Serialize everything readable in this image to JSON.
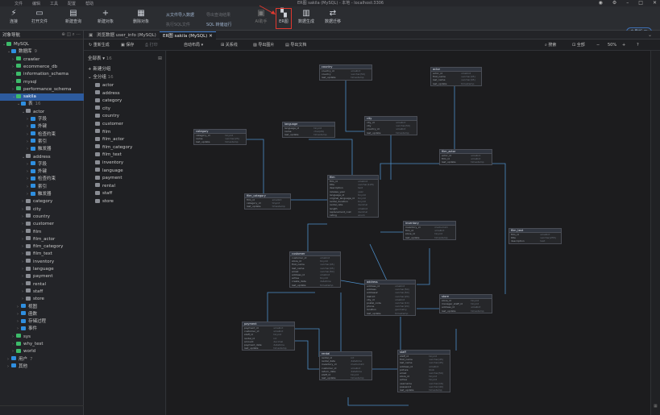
{
  "window": {
    "title": "ER图 sakila (MySQL) - 本地 - localhost:3306"
  },
  "menu": [
    "文件",
    "编辑",
    "工具",
    "配置",
    "帮助"
  ],
  "toolbar": {
    "connect": "连接",
    "open_file": "打开文件",
    "new_query": "新建查询",
    "new_object": "新建对象",
    "delete_object": "删除对象",
    "import_from_file": "从文件导入数据",
    "export_results": "导出查询结果",
    "execute_sql": "执行SQL文件",
    "export_wizard": "导出向导",
    "run_sql": "SQL 转储运行",
    "ai_assistant": "AI助手",
    "er_diagram": "ER图",
    "data_generation": "数据生成",
    "data_comparison": "数据迁移",
    "vip_badge": "会员版 AI"
  },
  "left_pane": {
    "title": "对象导航",
    "connection": "MySQL",
    "group_db": "数据库",
    "count_db": "9",
    "databases": [
      "crawler",
      "ecommerce_db",
      "information_schema",
      "mysql",
      "performance_schema",
      "sakila",
      "sys",
      "why_test",
      "world"
    ],
    "sakila_children": {
      "tables_label": "表",
      "tables_count": "16",
      "actor": "actor",
      "actor_children": [
        "字段",
        "外键",
        "检查约束",
        "索引",
        "触发器"
      ],
      "address": "address",
      "address_children": [
        "字段",
        "外键",
        "检查约束",
        "索引",
        "触发器"
      ],
      "tables": [
        "category",
        "city",
        "country",
        "customer",
        "film",
        "film_actor",
        "film_category",
        "film_text",
        "inventory",
        "language",
        "payment",
        "rental",
        "staff",
        "store"
      ],
      "views": "视图",
      "functions": "函数",
      "procedures": "存储过程",
      "events": "事件"
    },
    "users": "用户",
    "users_count": "7",
    "others": "其他"
  },
  "tabs": [
    {
      "label": "浏览数据 user_info (MySQL)"
    },
    {
      "label": "ER图 sakila (MySQL)"
    }
  ],
  "editor_toolbar": {
    "new_model": "重新生成",
    "save": "保存",
    "print": "打印",
    "arrange": "自动布局",
    "export_image": "导出图片",
    "export_pdf": "导出文档",
    "relationship": "关系线",
    "zoom": "50%",
    "search": "搜索",
    "fit": "全部"
  },
  "object_list": {
    "all_tables": "全部表",
    "count": "16",
    "new_group": "新建分组",
    "all_group": "全分组",
    "group_count": "16",
    "tables": [
      "actor",
      "address",
      "category",
      "city",
      "country",
      "customer",
      "film",
      "film_actor",
      "film_category",
      "film_text",
      "inventory",
      "language",
      "payment",
      "rental",
      "staff",
      "store"
    ]
  },
  "entities": [
    {
      "name": "country",
      "rows": [
        [
          "country_id",
          "smallint"
        ],
        [
          "country",
          "varchar(50)"
        ],
        [
          "last_update",
          "timestamp"
        ]
      ]
    },
    {
      "name": "actor",
      "rows": [
        [
          "actor_id",
          "smallint"
        ],
        [
          "first_name",
          "varchar(45)"
        ],
        [
          "last_name",
          "varchar(45)"
        ],
        [
          "last_update",
          "timestamp"
        ]
      ]
    },
    {
      "name": "category",
      "rows": [
        [
          "category_id",
          "tinyint"
        ],
        [
          "name",
          "varchar(25)"
        ],
        [
          "last_update",
          "timestamp"
        ]
      ]
    },
    {
      "name": "language",
      "rows": [
        [
          "language_id",
          "tinyint"
        ],
        [
          "name",
          "char(20)"
        ],
        [
          "last_update",
          "timestamp"
        ]
      ]
    },
    {
      "name": "city",
      "rows": [
        [
          "city_id",
          "smallint"
        ],
        [
          "city",
          "varchar(50)"
        ],
        [
          "country_id",
          "smallint"
        ],
        [
          "last_update",
          "timestamp"
        ]
      ]
    },
    {
      "name": "film_actor",
      "rows": [
        [
          "actor_id",
          "smallint"
        ],
        [
          "film_id",
          "smallint"
        ],
        [
          "last_update",
          "timestamp"
        ]
      ]
    },
    {
      "name": "film",
      "rows": [
        [
          "film_id",
          "smallint"
        ],
        [
          "title",
          "varchar(128)"
        ],
        [
          "description",
          "text"
        ],
        [
          "release_year",
          "year"
        ],
        [
          "language_id",
          "tinyint"
        ],
        [
          "original_language_id",
          "tinyint"
        ],
        [
          "rental_duration",
          "tinyint"
        ],
        [
          "rental_rate",
          "decimal"
        ],
        [
          "length",
          "smallint"
        ],
        [
          "replacement_cost",
          "decimal"
        ],
        [
          "rating",
          "enum"
        ]
      ]
    },
    {
      "name": "film_category",
      "rows": [
        [
          "film_id",
          "smallint"
        ],
        [
          "category_id",
          "tinyint"
        ],
        [
          "last_update",
          "timestamp"
        ]
      ]
    },
    {
      "name": "inventory",
      "rows": [
        [
          "inventory_id",
          "mediumint"
        ],
        [
          "film_id",
          "smallint"
        ],
        [
          "store_id",
          "tinyint"
        ],
        [
          "last_update",
          "timestamp"
        ]
      ]
    },
    {
      "name": "film_text",
      "rows": [
        [
          "film_id",
          "smallint"
        ],
        [
          "title",
          "varchar(255)"
        ],
        [
          "description",
          "text"
        ]
      ]
    },
    {
      "name": "customer",
      "rows": [
        [
          "customer_id",
          "smallint"
        ],
        [
          "store_id",
          "tinyint"
        ],
        [
          "first_name",
          "varchar(45)"
        ],
        [
          "last_name",
          "varchar(45)"
        ],
        [
          "email",
          "varchar(50)"
        ],
        [
          "address_id",
          "smallint"
        ],
        [
          "active",
          "tinyint"
        ],
        [
          "create_date",
          "datetime"
        ],
        [
          "last_update",
          "timestamp"
        ]
      ]
    },
    {
      "name": "address",
      "rows": [
        [
          "address_id",
          "smallint"
        ],
        [
          "address",
          "varchar(50)"
        ],
        [
          "address2",
          "varchar(50)"
        ],
        [
          "district",
          "varchar(20)"
        ],
        [
          "city_id",
          "smallint"
        ],
        [
          "postal_code",
          "varchar(10)"
        ],
        [
          "phone",
          "varchar(20)"
        ],
        [
          "location",
          "geometry"
        ],
        [
          "last_update",
          "timestamp"
        ]
      ]
    },
    {
      "name": "store",
      "rows": [
        [
          "store_id",
          "tinyint"
        ],
        [
          "manager_staff_id",
          "tinyint"
        ],
        [
          "address_id",
          "smallint"
        ],
        [
          "last_update",
          "timestamp"
        ]
      ]
    },
    {
      "name": "payment",
      "rows": [
        [
          "payment_id",
          "smallint"
        ],
        [
          "customer_id",
          "smallint"
        ],
        [
          "staff_id",
          "tinyint"
        ],
        [
          "rental_id",
          "int"
        ],
        [
          "amount",
          "decimal"
        ],
        [
          "payment_date",
          "datetime"
        ],
        [
          "last_update",
          "timestamp"
        ]
      ]
    },
    {
      "name": "rental",
      "rows": [
        [
          "rental_id",
          "int"
        ],
        [
          "rental_date",
          "datetime"
        ],
        [
          "inventory_id",
          "mediumint"
        ],
        [
          "customer_id",
          "smallint"
        ],
        [
          "return_date",
          "datetime"
        ],
        [
          "staff_id",
          "tinyint"
        ],
        [
          "last_update",
          "timestamp"
        ]
      ]
    },
    {
      "name": "staff",
      "rows": [
        [
          "staff_id",
          "tinyint"
        ],
        [
          "first_name",
          "varchar(45)"
        ],
        [
          "last_name",
          "varchar(45)"
        ],
        [
          "address_id",
          "smallint"
        ],
        [
          "picture",
          "blob"
        ],
        [
          "email",
          "varchar(50)"
        ],
        [
          "store_id",
          "tinyint"
        ],
        [
          "active",
          "tinyint"
        ],
        [
          "username",
          "varchar(16)"
        ],
        [
          "password",
          "varchar(40)"
        ],
        [
          "last_update",
          "timestamp"
        ]
      ]
    }
  ]
}
